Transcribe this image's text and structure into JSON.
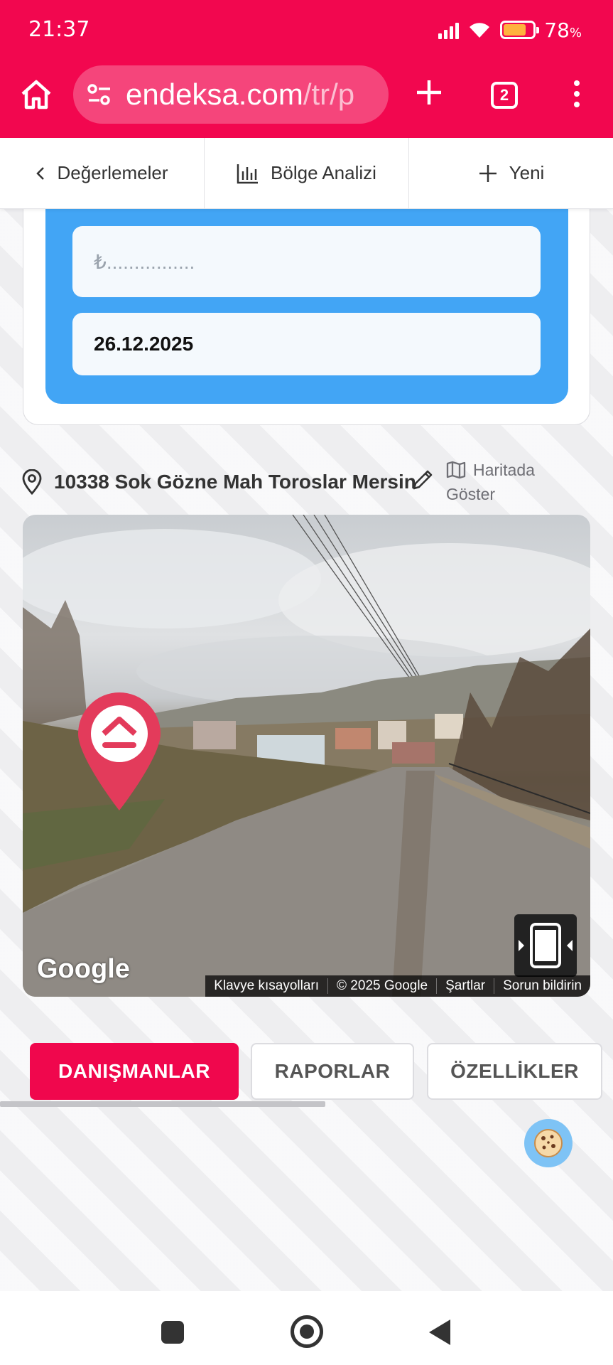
{
  "status_bar": {
    "time": "21:37",
    "battery_percent": "78",
    "battery_unit": "%",
    "battery_level": 0.78,
    "icons": [
      "signal-icon",
      "wifi-icon",
      "battery-icon"
    ]
  },
  "browser": {
    "url_main": "endeksa.com",
    "url_path": "/tr/p",
    "tab_count": "2",
    "theme_color": "#f2074f"
  },
  "app_nav": {
    "back_label": "Değerlemeler",
    "analysis_label": "Bölge Analizi",
    "new_label": "Yeni"
  },
  "form": {
    "price_placeholder": "₺................",
    "date_value": "26.12.2025"
  },
  "address": {
    "text": "10338 Sok Gözne Mah Toroslar Mersin",
    "map_link": "Haritada Göster"
  },
  "street_view": {
    "logo": "Google",
    "footer": [
      "Klavye kısayolları",
      "© 2025 Google",
      "Şartlar",
      "Sorun bildirin"
    ]
  },
  "tabs": [
    {
      "label": "DANIŞMANLAR",
      "active": true
    },
    {
      "label": "RAPORLAR",
      "active": false
    },
    {
      "label": "ÖZELLİKLER",
      "active": false
    }
  ],
  "colors": {
    "accent": "#f0074d",
    "panel_blue": "#42a5f5"
  }
}
